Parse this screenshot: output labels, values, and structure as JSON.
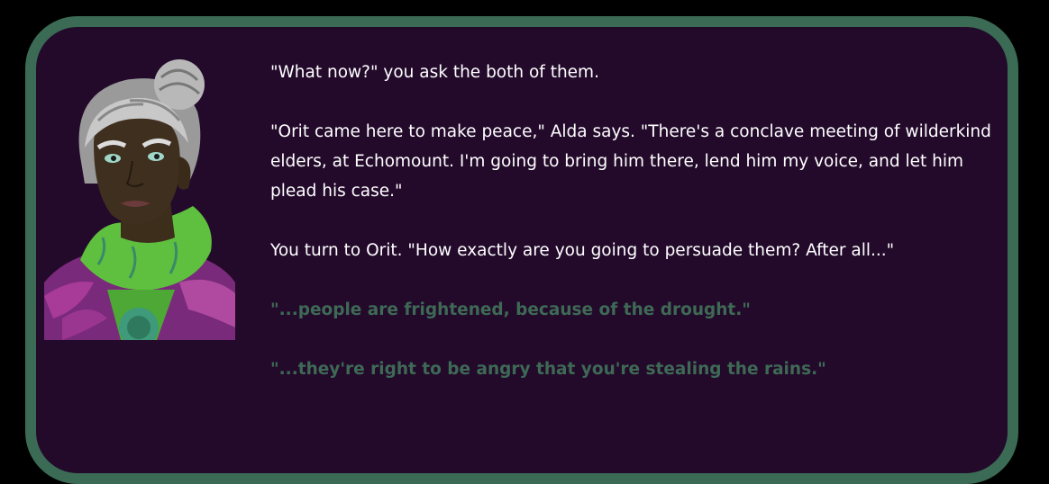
{
  "story": {
    "paragraphs": [
      "\"What now?\" you ask the both of them.",
      "\"Orit came here to make peace,\" Alda says. \"There's a conclave meeting of wilderkind elders, at Echomount. I'm going to bring him there, lend him my voice, and let him plead his case.\"",
      "You turn to Orit. \"How exactly are you going to persuade them? After all...\""
    ]
  },
  "choices": [
    "\"...people are frightened, because of the drought.\"",
    "\"...they're right to be angry that you're stealing the rains.\""
  ],
  "colors": {
    "background": "#230a2b",
    "border": "#3b6b55",
    "choice_text": "#3e6a55",
    "story_text": "#ffffff"
  },
  "portrait": {
    "icon": "elderly-woman-portrait"
  }
}
